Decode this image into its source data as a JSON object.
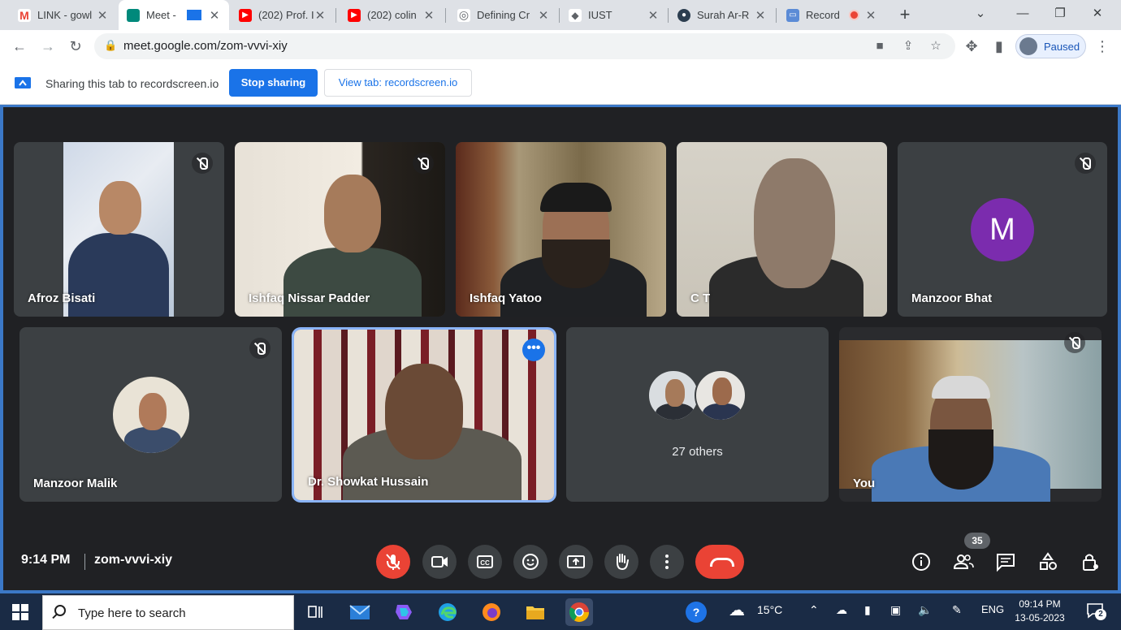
{
  "browser": {
    "tabs": [
      {
        "title": "LINK - gowl",
        "color": "#ea4335",
        "glyph": "M"
      },
      {
        "title": "Meet -",
        "color": "#00897b",
        "glyph": ""
      },
      {
        "title": "(202) Prof. I",
        "color": "#ff0000",
        "glyph": "▶"
      },
      {
        "title": "(202) colin",
        "color": "#ff0000",
        "glyph": "▶"
      },
      {
        "title": "Defining Cr",
        "color": "#5f6368",
        "glyph": "◎"
      },
      {
        "title": "IUST",
        "color": "#5f6368",
        "glyph": "◆"
      },
      {
        "title": "Surah Ar-R",
        "color": "#2c3e50",
        "glyph": "●"
      },
      {
        "title": "Record",
        "color": "#5b8bd6",
        "glyph": "▭"
      }
    ],
    "url": "meet.google.com/zom-vvvi-xiy",
    "profile_status": "Paused"
  },
  "sharebar": {
    "message": "Sharing this tab to recordscreen.io",
    "stop_label": "Stop sharing",
    "view_label": "View tab: recordscreen.io"
  },
  "participants": [
    {
      "name": "Afroz Bisati",
      "muted": true
    },
    {
      "name": "Ishfaq Nissar Padder",
      "muted": true
    },
    {
      "name": "Ishfaq Yatoo",
      "muted": false
    },
    {
      "name": "C T",
      "muted": false
    },
    {
      "name": "Manzoor Bhat",
      "muted": true,
      "initial": "M"
    },
    {
      "name": "Manzoor Malik",
      "muted": true
    },
    {
      "name": "Dr. Showkat Hussain",
      "muted": false,
      "speaking": true
    },
    {
      "name": "27 others"
    },
    {
      "name": "You",
      "muted": true
    }
  ],
  "meeting": {
    "time": "9:14 PM",
    "code": "zom-vvvi-xiy",
    "participant_count": "35"
  },
  "taskbar": {
    "search_placeholder": "Type here to search",
    "weather": "15°C",
    "language": "ENG",
    "clock_time": "09:14 PM",
    "clock_date": "13-05-2023",
    "notifications": "2"
  }
}
